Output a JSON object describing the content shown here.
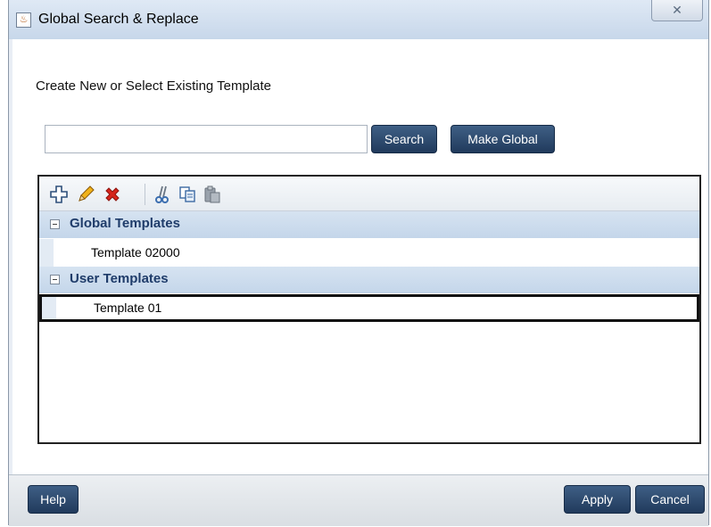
{
  "window": {
    "title": "Global Search & Replace",
    "close_glyph": "✕",
    "accent": "#2c4a70"
  },
  "main": {
    "prompt": "Create New or Select Existing Template",
    "search": {
      "value": "",
      "placeholder": ""
    },
    "buttons": {
      "search": "Search",
      "make_global": "Make Global"
    }
  },
  "toolbar": {
    "icons": [
      "add-icon",
      "edit-pencil-icon",
      "delete-icon",
      "cut-icon",
      "copy-icon",
      "paste-icon"
    ]
  },
  "tree": {
    "groups": [
      {
        "label": "Global Templates",
        "items": [
          "Template 02000"
        ]
      },
      {
        "label": "User Templates",
        "items": [
          "Template 01"
        ]
      }
    ],
    "selected_item": "Template 01"
  },
  "footer": {
    "help": "Help",
    "apply": "Apply",
    "cancel": "Cancel"
  }
}
